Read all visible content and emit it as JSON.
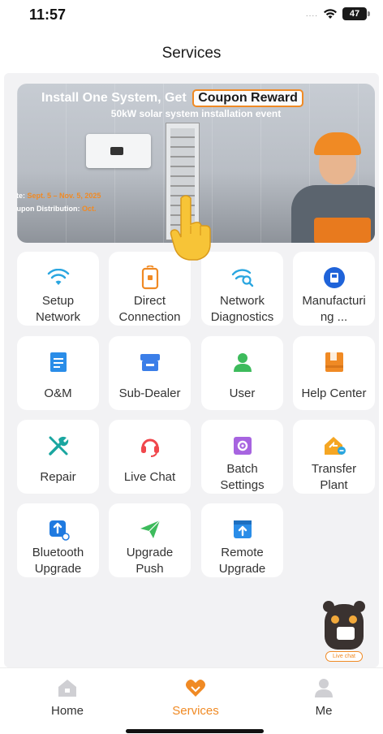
{
  "status_bar": {
    "time": "11:57",
    "signal": "....",
    "battery": "47"
  },
  "header": {
    "title": "Services"
  },
  "banner": {
    "headline": "Install One System, Get",
    "headline_highlight": "Coupon Reward",
    "subtitle": "50kW solar system installation event",
    "date_label": "ate:",
    "date_value": "Sept. 5 – Nov. 5, 2025",
    "coupon_label": "oupon Distribution:",
    "coupon_value": "Oct."
  },
  "services": [
    {
      "label": "Setup\nNetwork",
      "icon": "wifi-icon",
      "color": "#2aa6e0"
    },
    {
      "label": "Direct\nConnection",
      "icon": "phone-connect-icon",
      "color": "#f08a24"
    },
    {
      "label": "Network\nDiagnostics",
      "icon": "wifi-search-icon",
      "color": "#2aa6e0"
    },
    {
      "label": "Manufacturi\nng ...",
      "icon": "manufacturing-icon",
      "color": "#1f63d9"
    },
    {
      "label": "O&M",
      "icon": "document-icon",
      "color": "#2a8de8"
    },
    {
      "label": "Sub-Dealer",
      "icon": "store-icon",
      "color": "#3b7ee8"
    },
    {
      "label": "User",
      "icon": "user-icon",
      "color": "#3dbb5c"
    },
    {
      "label": "Help Center",
      "icon": "help-book-icon",
      "color": "#f08a24"
    },
    {
      "label": "Repair",
      "icon": "wrench-icon",
      "color": "#1aa6a0"
    },
    {
      "label": "Live Chat",
      "icon": "headset-icon",
      "color": "#f0474c"
    },
    {
      "label": "Batch\nSettings",
      "icon": "batch-settings-icon",
      "color": "#a764e0"
    },
    {
      "label": "Transfer\nPlant",
      "icon": "transfer-house-icon",
      "color": "#f5a623"
    },
    {
      "label": "Bluetooth\nUpgrade",
      "icon": "bluetooth-upgrade-icon",
      "color": "#1f7ae0"
    },
    {
      "label": "Upgrade\nPush",
      "icon": "send-icon",
      "color": "#3dbb5c"
    },
    {
      "label": "Remote\nUpgrade",
      "icon": "remote-upgrade-icon",
      "color": "#2a8de8"
    }
  ],
  "chat_widget": {
    "label": "Live chat"
  },
  "tabbar": {
    "items": [
      {
        "label": "Home",
        "icon": "home-icon"
      },
      {
        "label": "Services",
        "icon": "services-icon",
        "active": true
      },
      {
        "label": "Me",
        "icon": "person-icon"
      }
    ],
    "active_color": "#f08a24"
  }
}
